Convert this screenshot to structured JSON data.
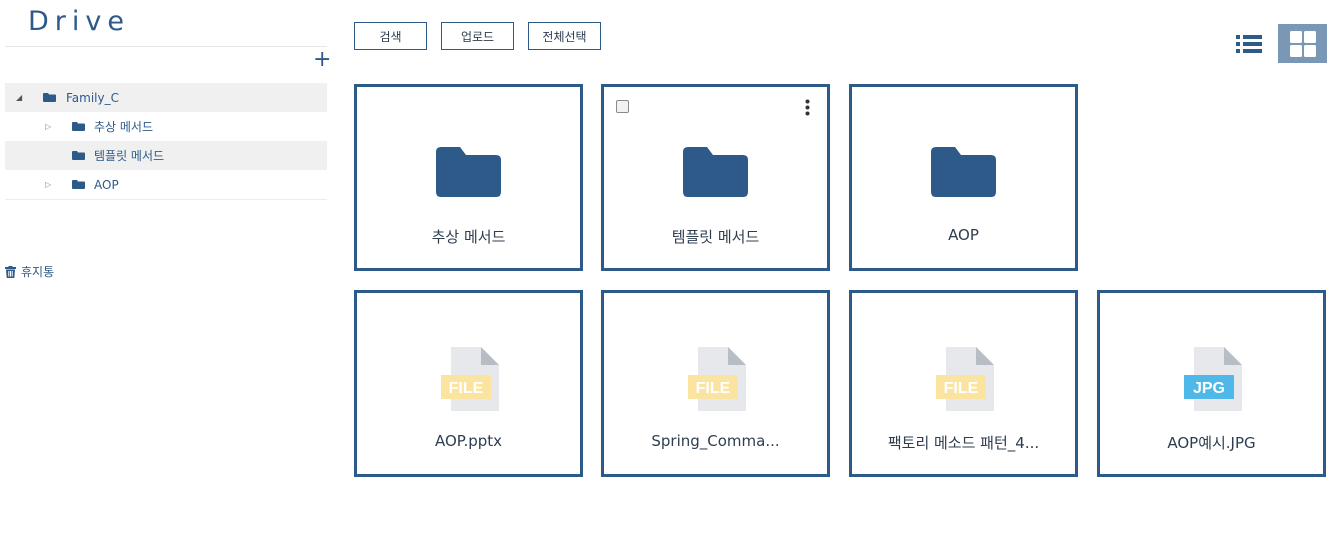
{
  "app": {
    "logo": "Drive"
  },
  "sidebar": {
    "add_label": "+",
    "tree": [
      {
        "label": "Family_C",
        "expanded": true,
        "active": true
      },
      {
        "label": "추상 메서드",
        "expanded": false,
        "active": false
      },
      {
        "label": "템플릿 메서드",
        "expanded": false,
        "active": true
      },
      {
        "label": "AOP",
        "expanded": false,
        "active": false
      }
    ],
    "trash_label": "휴지통"
  },
  "toolbar": {
    "search_label": "검색",
    "upload_label": "업로드",
    "select_all_label": "전체선택"
  },
  "colors": {
    "brand": "#2e5a8a",
    "view_active": "#7a97b6",
    "file_badge": "#fbe3a0",
    "jpg_badge": "#4fb8e8"
  },
  "folders": [
    {
      "name": "추상 메서드",
      "icon": "folder-icon"
    },
    {
      "name": "템플릿 메서드",
      "icon": "folder-icon",
      "hovered": true
    },
    {
      "name": "AOP",
      "icon": "folder-icon"
    }
  ],
  "files": [
    {
      "name": "AOP.pptx",
      "badge": "FILE"
    },
    {
      "name": "Spring_Comma...",
      "badge": "FILE"
    },
    {
      "name": "팩토리 메소드 패턴_4...",
      "badge": "FILE"
    },
    {
      "name": "AOP예시.JPG",
      "badge": "JPG"
    }
  ]
}
